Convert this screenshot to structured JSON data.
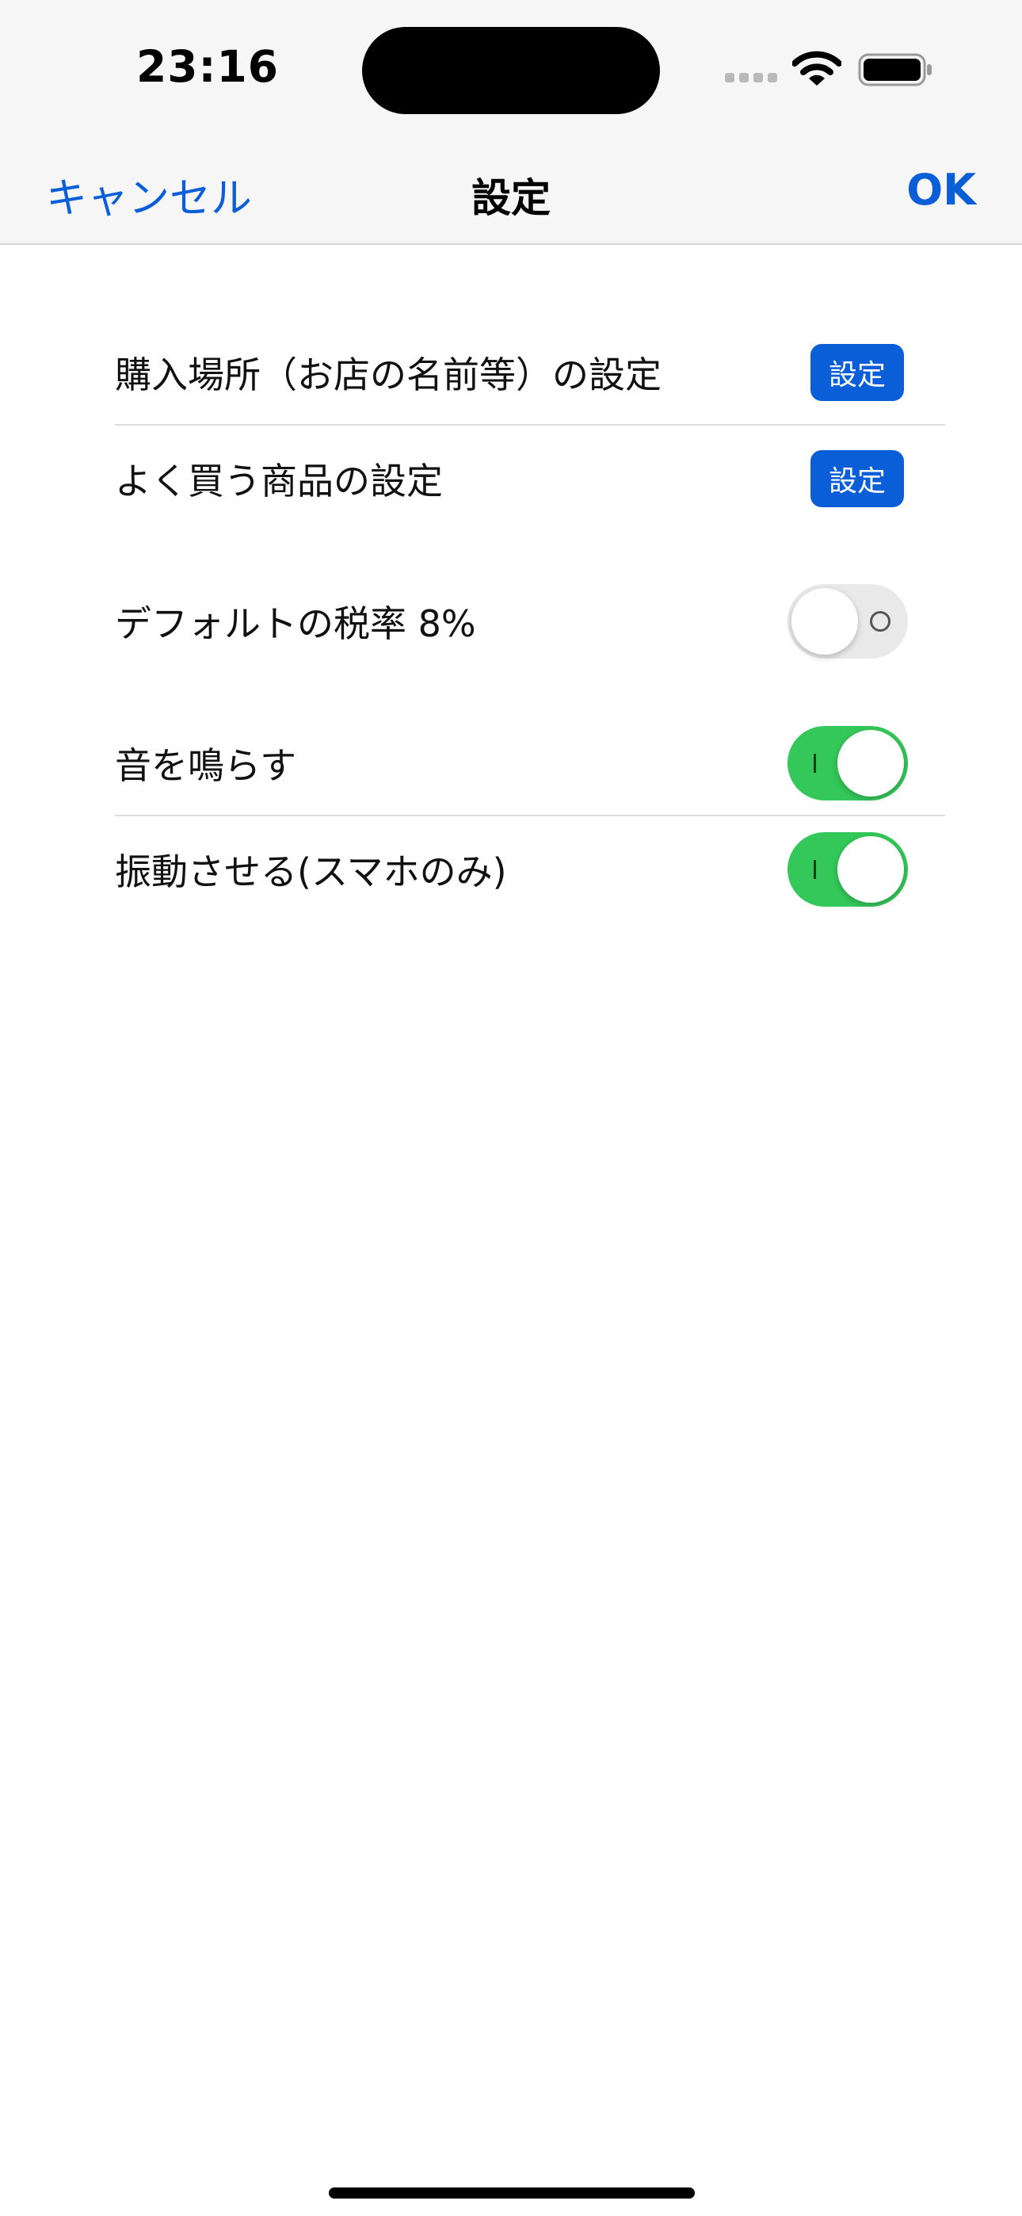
{
  "status_bar": {
    "time": "23:16",
    "signal_icon": "cellular-signal-icon",
    "wifi_icon": "wifi-icon",
    "battery_icon": "battery-icon"
  },
  "nav": {
    "cancel_label": "キャンセル",
    "title": "設定",
    "ok_label": "OK"
  },
  "settings": {
    "store_row": {
      "label": "購入場所（お店の名前等）の設定",
      "button_label": "設定"
    },
    "product_row": {
      "label": "よく買う商品の設定",
      "button_label": "設定"
    },
    "tax_row": {
      "label": "デフォルトの税率 8%",
      "toggle_on": false
    },
    "sound_row": {
      "label": "音を鳴らす",
      "toggle_on": true
    },
    "vibrate_row": {
      "label": "振動させる(スマホのみ)",
      "toggle_on": true
    }
  },
  "colors": {
    "accent": "#0a5ed7",
    "toggle_on": "#34c759",
    "toggle_off": "#e9e9ea",
    "nav_background": "#f6f6f6"
  }
}
